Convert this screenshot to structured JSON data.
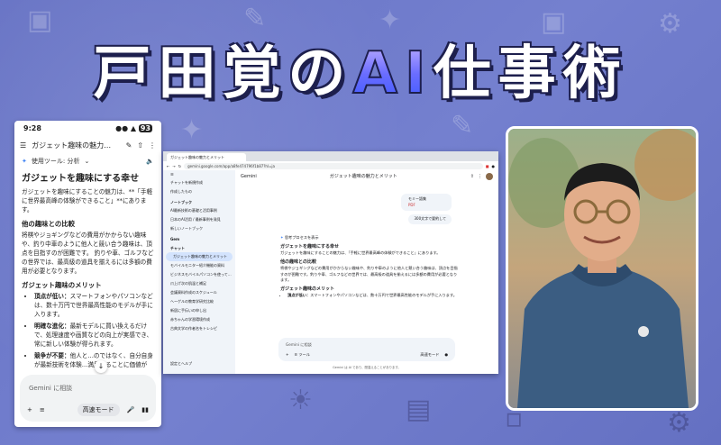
{
  "banner": {
    "title_part1": "戸田覚の",
    "title_ai": "AI",
    "title_part2": "仕事術"
  },
  "phone": {
    "status": {
      "time": "9:28",
      "battery": "93"
    },
    "appbar": {
      "title": "ガジェット趣味の魅力…"
    },
    "tools_label": "使用ツール: 分析",
    "heading": "ガジェットを趣味にする幸せ",
    "intro": "ガジェットを趣味にすることの魅力は、**「手軽に世界最高峰の体験ができること」**にあります。",
    "section1_title": "他の趣味との比較",
    "section1_body": "将棋やジョギングなどの費用がかからない趣味や、釣り中車のように他人と競い合う趣味は、頂点を目指すのが困難です。 釣りや車、ゴルフなどの世界では、最高級の道具を揃えるには多額の費用が必要となります。",
    "section2_title": "ガジェット趣味のメリット",
    "bullets": [
      {
        "label": "頂点が低い：",
        "text": "スマートフォンやパソコンなどは、数十万円で世界最高性能のモデルが手に入ります。"
      },
      {
        "label": "明確な進化：",
        "text": "最新モデルに買い換えるだけで、処理速度や画質などの向上が実感でき、常に新しい体験が得られます。"
      },
      {
        "label": "競争が不要：",
        "text": "他人と…のではなく、自分自身が最新技術を体験…満足することに価値が"
      }
    ],
    "composer_placeholder": "Gemini に相談",
    "mode_label": "高速モード"
  },
  "browser": {
    "tab_title": "ガジェット趣味の魅力とメリット",
    "url": "gemini.google.com/app/a8fe474796f1b87?hl=ja",
    "app_name": "Gemini",
    "chat_title": "ガジェット趣味の魅力とメリット",
    "sidebar": {
      "items_top": [
        "チャットを新規作成",
        "作成したもの"
      ],
      "notebook_header": "ノートブック",
      "notebooks": [
        "AI最新技術の基礎と活用事例",
        "日本のAI活用 / 最新事例を発見",
        "新しいノートブック"
      ],
      "gems_header": "Gem",
      "chats_header": "チャット",
      "chats": [
        "ガジェット趣味の魅力とメリット",
        "モバイルモニター紹介機能の資料",
        "ビジネスモバイルパソコンを使って…",
        "爪上げ次の肌温と補足",
        "会議資料作成のスケジュール",
        "ヘーゲルの教育学研究比較",
        "新居に手伝いの申し出",
        "赤ちゃんの学習環境作成",
        "古典文学の作者名をトレシピ"
      ],
      "settings": "設定とヘルプ"
    },
    "user_bubble_title": "モミー語集",
    "user_bubble_file": "PDF",
    "user_bubble2": "300文字で要約して",
    "thinking_label": "思考プロセスを表示",
    "answer": {
      "heading": "ガジェットを趣味にする幸せ",
      "intro": "ガジェットを趣味にすることの魅力は、「手軽に世界最高峰の体験ができること」にあります。",
      "s1": "他の趣味との比較",
      "s1_body": "将棋やジョギングなどの費用がかからない趣味や、釣り中車のように他人と競い合う趣味は、頂点を目指すのが困難です。釣りや車、ゴルフなどの世界では、最高級の道具を揃えるには多額の費用が必要となります。",
      "s2": "ガジェット趣味のメリット",
      "b1_label": "頂点が低い：",
      "b1": "スマートフォンやパソコンなどは、数十万円で世界最高性能のモデルが手に入ります。"
    },
    "compose_placeholder": "Gemini に相談",
    "tools": "ツール",
    "mode": "高速モード",
    "footer": "Gemini は AI であり、間違えることがあります。"
  },
  "colors": {
    "accent": "#4285f4",
    "background": "#6c77c8"
  }
}
